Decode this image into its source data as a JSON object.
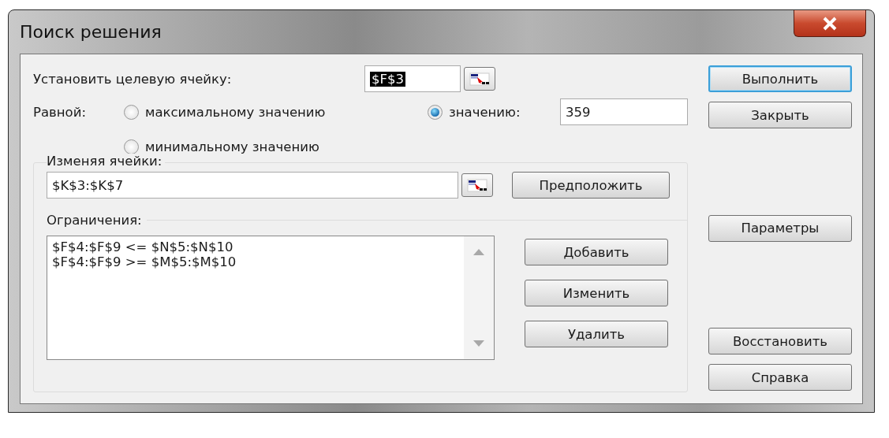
{
  "window": {
    "title": "Поиск решения"
  },
  "target_cell": {
    "label": "Установить целевую ячейку:",
    "value": "$F$3",
    "value_selected": true
  },
  "equal_to": {
    "label": "Равной:",
    "options": [
      {
        "label": "максимальному значению",
        "selected": false
      },
      {
        "label": "значению:",
        "selected": true
      },
      {
        "label": "минимальному значению",
        "selected": false
      }
    ],
    "value": "359"
  },
  "changing_cells": {
    "label": "Изменяя ячейки:",
    "value": "$K$3:$K$7",
    "button": {
      "label": "Предположить"
    }
  },
  "constraints": {
    "label": "Ограничения:",
    "items": [
      "$F$4:$F$9 <= $N$5:$N$10",
      "$F$4:$F$9 >= $M$5:$M$10"
    ],
    "buttons": [
      {
        "label": "Добавить"
      },
      {
        "label": "Изменить"
      },
      {
        "label": "Удалить"
      }
    ]
  },
  "button_groups": [
    [
      {
        "label": "Выполнить",
        "default": true
      },
      {
        "label": "Закрыть",
        "default": false
      }
    ],
    [
      {
        "label": "Параметры",
        "default": false
      }
    ],
    [
      {
        "label": "Восстановить",
        "default": false
      },
      {
        "label": "Справка",
        "default": false
      }
    ]
  ]
}
